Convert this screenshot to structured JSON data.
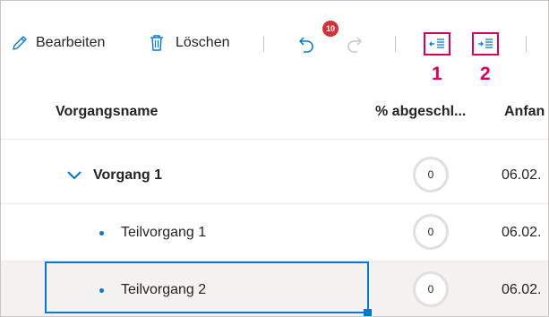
{
  "toolbar": {
    "edit_label": "Bearbeiten",
    "delete_label": "Löschen",
    "undo_badge": "10",
    "outdent_marker": "1",
    "indent_marker": "2"
  },
  "columns": {
    "name": "Vorgangsname",
    "percent": "% abgeschl...",
    "start": "Anfan"
  },
  "rows": [
    {
      "name": "Vorgang 1",
      "percent": "0",
      "start": "06.02.",
      "level": "summary",
      "expanded": true
    },
    {
      "name": "Teilvorgang 1",
      "percent": "0",
      "start": "06.02.",
      "level": "subtask"
    },
    {
      "name": "Teilvorgang 2",
      "percent": "0",
      "start": "06.02.",
      "level": "subtask",
      "selected": true
    }
  ],
  "colors": {
    "accent": "#0078d4",
    "highlight": "#d9005b",
    "badge": "#d13438"
  }
}
